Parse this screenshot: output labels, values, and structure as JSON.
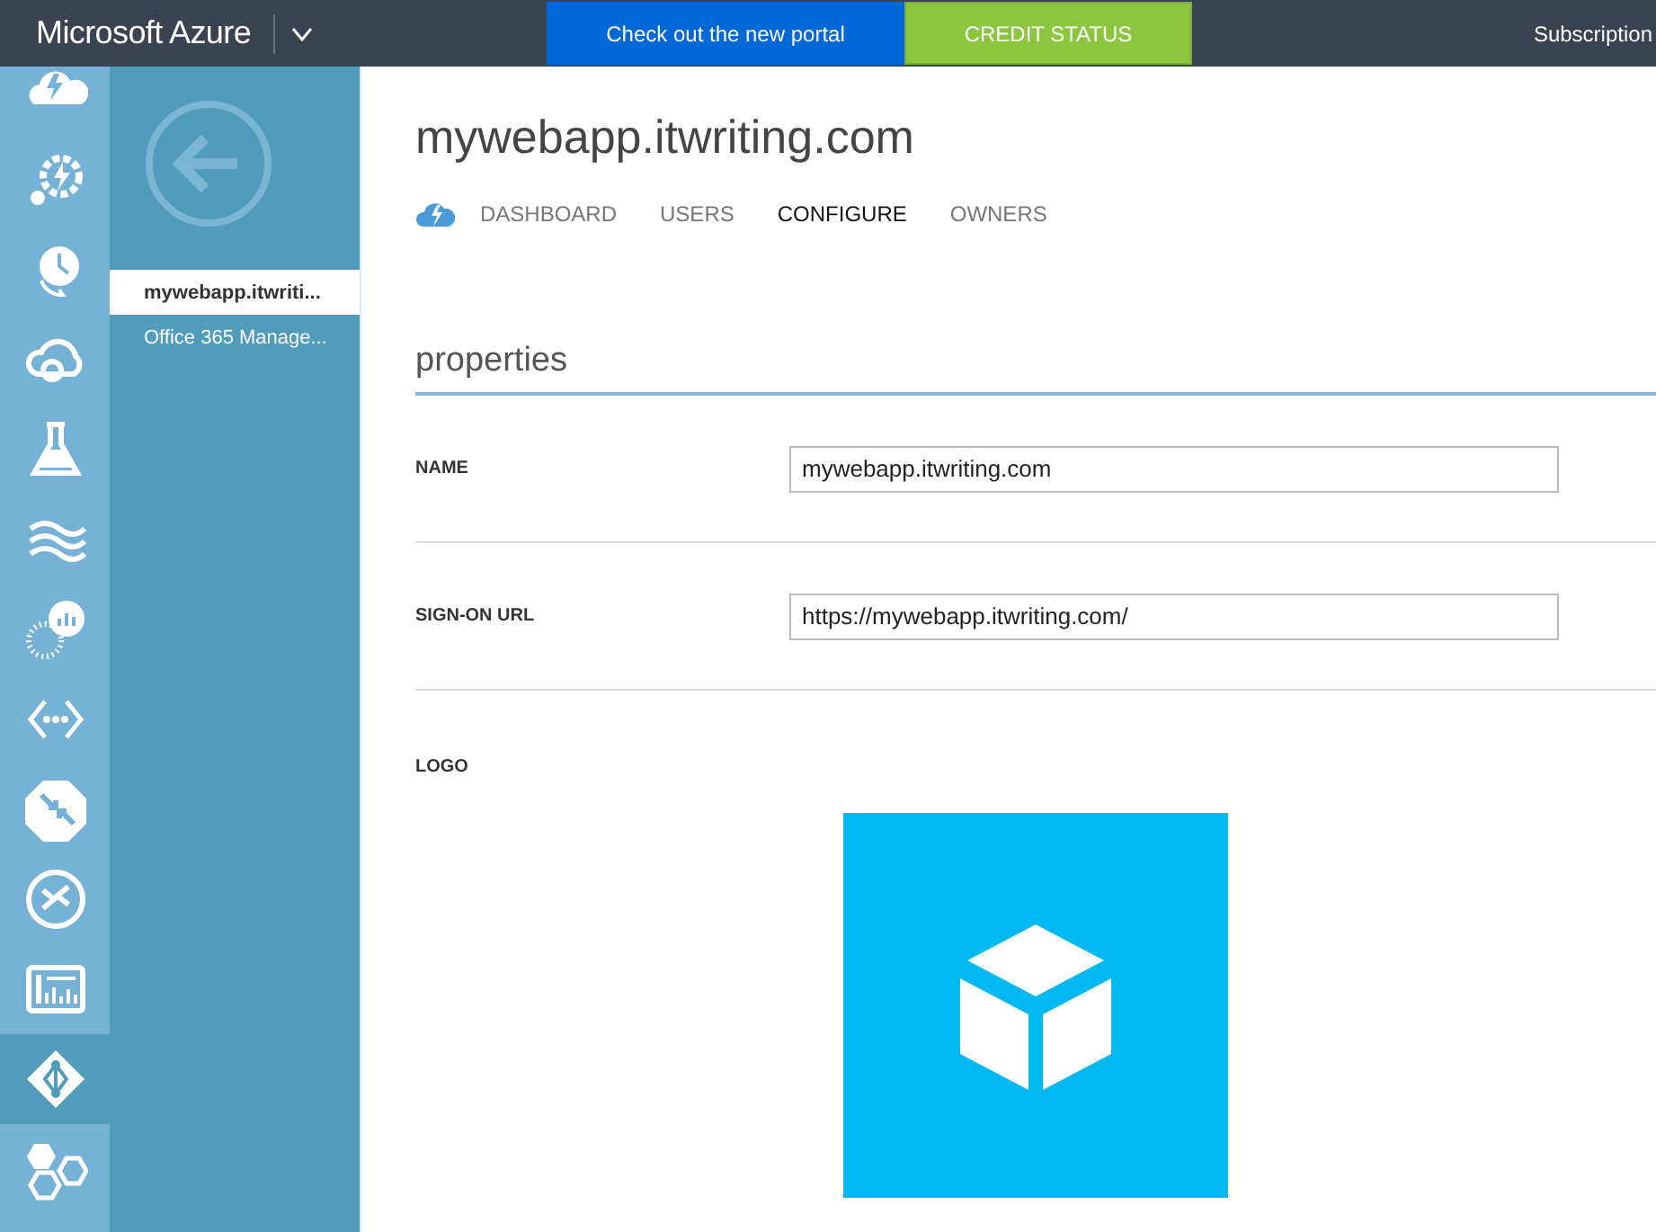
{
  "top_bar": {
    "brand": "Microsoft Azure",
    "buttons": [
      {
        "label": "Check out the new portal",
        "kind": "portal"
      },
      {
        "label": "CREDIT STATUS",
        "kind": "credit"
      }
    ],
    "subscriptions": "Subscription"
  },
  "nav_rail": [
    {
      "selected": false
    },
    {
      "selected": false
    },
    {
      "selected": false
    },
    {
      "selected": false
    },
    {
      "selected": false
    },
    {
      "selected": false
    },
    {
      "selected": false
    },
    {
      "selected": false
    },
    {
      "selected": false
    },
    {
      "selected": false
    },
    {
      "selected": false
    },
    {
      "selected": true
    },
    {
      "selected": false
    }
  ],
  "panel": {
    "items": [
      {
        "label": "mywebapp.itwriti...",
        "selected": true
      },
      {
        "label": "Office 365 Manage...",
        "selected": false
      }
    ]
  },
  "main": {
    "title": "mywebapp.itwriting.com",
    "tabs": [
      {
        "label": "DASHBOARD",
        "selected": false
      },
      {
        "label": "USERS",
        "selected": false
      },
      {
        "label": "CONFIGURE",
        "selected": true
      },
      {
        "label": "OWNERS",
        "selected": false
      }
    ],
    "section": "properties",
    "fields": [
      {
        "label": "NAME",
        "value": "mywebapp.itwriting.com",
        "kind": "text"
      },
      {
        "label": "SIGN-ON URL",
        "value": "https://mywebapp.itwriting.com/",
        "kind": "text"
      },
      {
        "label": "LOGO",
        "kind": "logo"
      }
    ]
  }
}
